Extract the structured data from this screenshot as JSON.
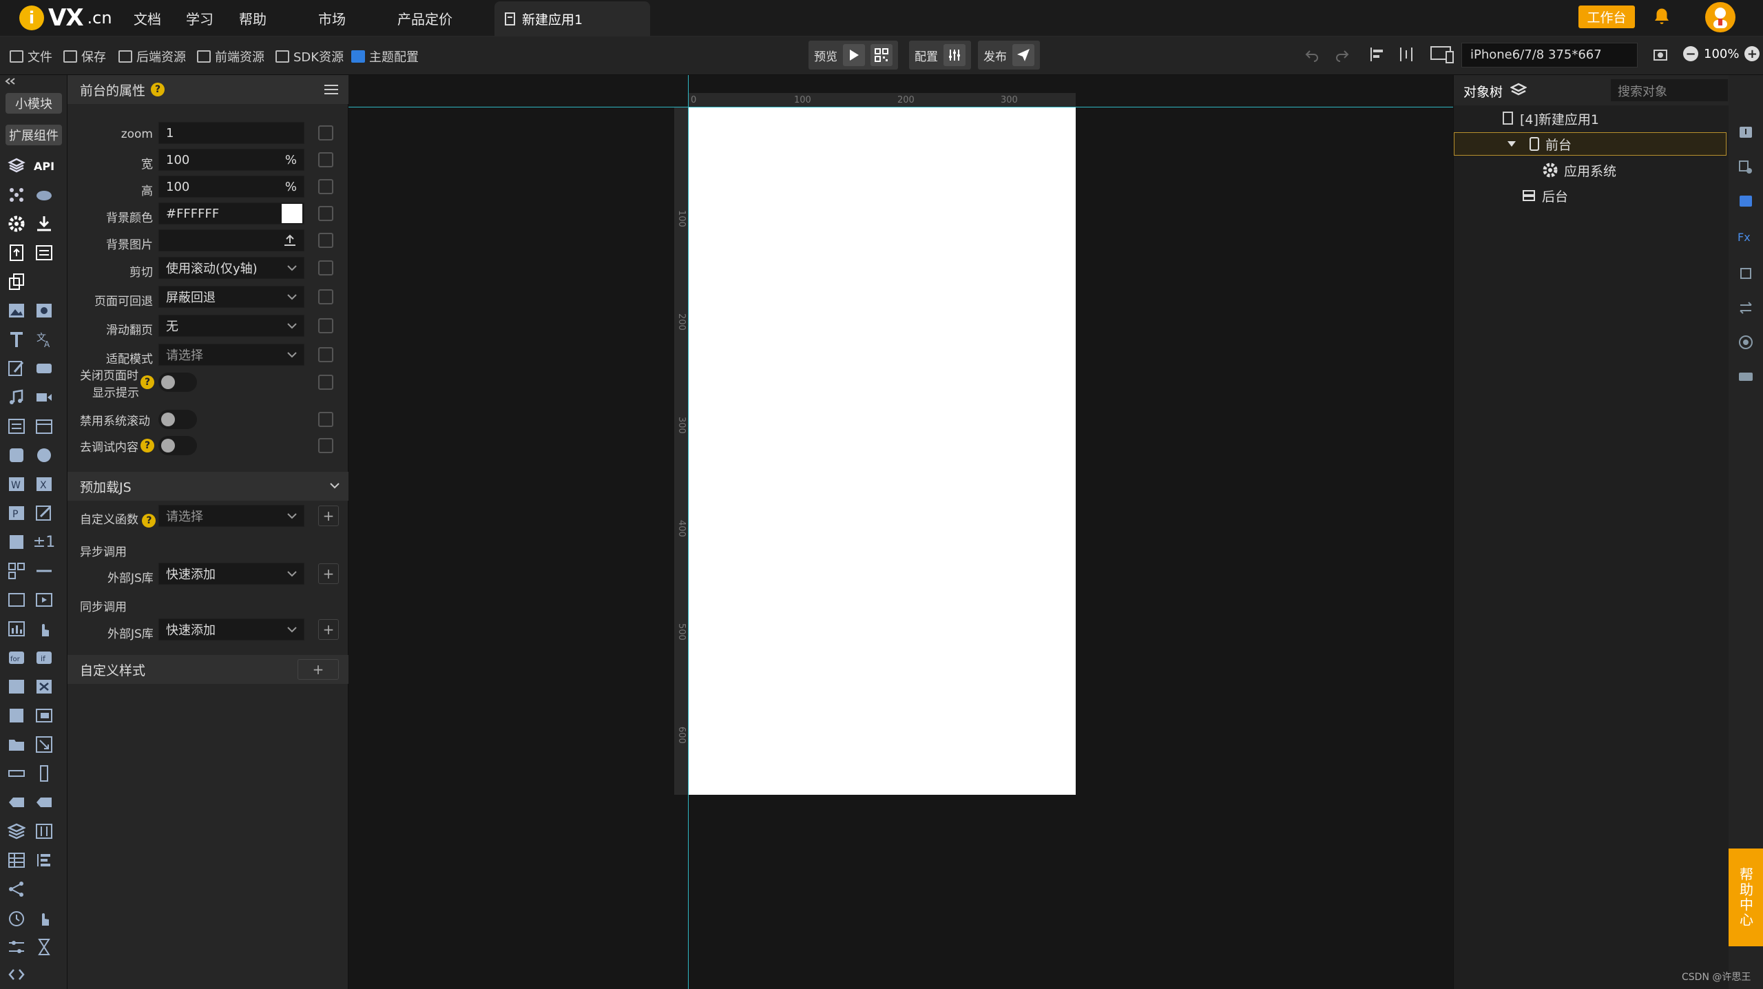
{
  "topbar": {
    "logo": "VX",
    "logo_cn": ".cn",
    "nav": [
      "文档",
      "学习",
      "帮助",
      "市场",
      "产品定价"
    ],
    "active_tab": "新建应用1",
    "workbench": "工作台"
  },
  "toolbar": {
    "file": "文件",
    "save": "保存",
    "backend": "后端资源",
    "frontend": "前端资源",
    "sdk": "SDK资源",
    "theme": "主题配置",
    "preview": "预览",
    "config": "配置",
    "publish": "发布",
    "device": "iPhone6/7/8 375*667",
    "zoom": "100%"
  },
  "iconbar": {
    "small_module": "小模块",
    "ext_component": "扩展组件",
    "api": "API"
  },
  "props": {
    "title": "前台的属性",
    "rows": [
      {
        "label": "zoom",
        "value": "1",
        "unit": ""
      },
      {
        "label": "宽",
        "value": "100",
        "unit": "%"
      },
      {
        "label": "高",
        "value": "100",
        "unit": "%"
      },
      {
        "label": "背景颜色",
        "value": "#FFFFFF",
        "unit": ""
      },
      {
        "label": "背景图片",
        "value": "",
        "unit": ""
      },
      {
        "label": "剪切",
        "value": "使用滚动(仅y轴)",
        "unit": ""
      },
      {
        "label": "页面可回退",
        "value": "屏蔽回退",
        "unit": ""
      },
      {
        "label": "滑动翻页",
        "value": "无",
        "unit": ""
      },
      {
        "label": "适配模式",
        "value": "请选择",
        "unit": ""
      }
    ],
    "toggles": [
      {
        "label": "关闭页面时",
        "label2": "显示提示",
        "on": false
      },
      {
        "label": "禁用系统滚动",
        "on": false
      },
      {
        "label": "去调试内容",
        "on": false
      }
    ],
    "preload_js": "预加载JS",
    "custom_func": "自定义函数",
    "custom_func_value": "请选择",
    "async_call": "异步调用",
    "ext_js": "外部JS库",
    "quick_add": "快速添加",
    "sync_call": "同步调用",
    "custom_style": "自定义样式",
    "plus": "+"
  },
  "canvas": {
    "ruler_h": [
      "0",
      "100",
      "200",
      "300"
    ],
    "ruler_v": [
      "100",
      "200",
      "300",
      "400",
      "500",
      "600"
    ]
  },
  "tree": {
    "title": "对象树",
    "search_placeholder": "搜索对象",
    "nodes": [
      "[4]新建应用1",
      "前台",
      "应用系统",
      "后台"
    ]
  },
  "help": "帮助中心",
  "watermark": "CSDN @许思王",
  "colors": {
    "accent": "#f4a100",
    "guide": "#2fb6c2",
    "selection": "#b8902d"
  }
}
